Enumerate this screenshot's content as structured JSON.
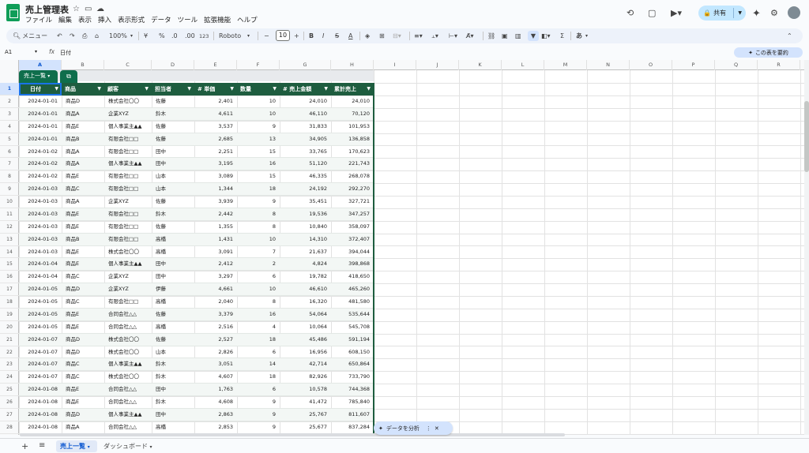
{
  "doc_title": "売上管理表",
  "title_icons": [
    "star-icon",
    "folder-icon",
    "cloud-icon"
  ],
  "menu": [
    "ファイル",
    "編集",
    "表示",
    "挿入",
    "表示形式",
    "データ",
    "ツール",
    "拡張機能",
    "ヘルプ"
  ],
  "share_label": "共有",
  "toolbar": {
    "search": "メニュー",
    "zoom": "100%",
    "currency": "¥",
    "percent": "%",
    "dec_less": ".0",
    "dec_more": ".00",
    "fmt123": "123",
    "font": "Roboto",
    "font_size": "10",
    "input_tools": "あ"
  },
  "formula": {
    "namebox": "A1",
    "fx": "fx",
    "value": "日付",
    "summarize": "この表を要約"
  },
  "col_letters": [
    "A",
    "B",
    "C",
    "D",
    "E",
    "F",
    "G",
    "H",
    "I",
    "J",
    "K",
    "L",
    "M",
    "N",
    "O",
    "P",
    "Q",
    "R"
  ],
  "table_name": "売上一覧",
  "headers": [
    "日付",
    "商品",
    "顧客",
    "担当者",
    "# 単価",
    "数量",
    "# 売上金額",
    "累計売上"
  ],
  "rows": [
    [
      "2024-01-01",
      "商品D",
      "株式会社〇〇",
      "佐藤",
      "2,401",
      "10",
      "24,010",
      "24,010"
    ],
    [
      "2024-01-01",
      "商品A",
      "企業XYZ",
      "鈴木",
      "4,611",
      "10",
      "46,110",
      "70,120"
    ],
    [
      "2024-01-01",
      "商品E",
      "個人事業主▲▲",
      "佐藤",
      "3,537",
      "9",
      "31,833",
      "101,953"
    ],
    [
      "2024-01-01",
      "商品B",
      "有限会社□□",
      "佐藤",
      "2,685",
      "13",
      "34,905",
      "136,858"
    ],
    [
      "2024-01-02",
      "商品A",
      "有限会社□□",
      "田中",
      "2,251",
      "15",
      "33,765",
      "170,623"
    ],
    [
      "2024-01-02",
      "商品A",
      "個人事業主▲▲",
      "田中",
      "3,195",
      "16",
      "51,120",
      "221,743"
    ],
    [
      "2024-01-02",
      "商品E",
      "有限会社□□",
      "山本",
      "3,089",
      "15",
      "46,335",
      "268,078"
    ],
    [
      "2024-01-03",
      "商品C",
      "有限会社□□",
      "山本",
      "1,344",
      "18",
      "24,192",
      "292,270"
    ],
    [
      "2024-01-03",
      "商品A",
      "企業XYZ",
      "佐藤",
      "3,939",
      "9",
      "35,451",
      "327,721"
    ],
    [
      "2024-01-03",
      "商品E",
      "有限会社□□",
      "鈴木",
      "2,442",
      "8",
      "19,536",
      "347,257"
    ],
    [
      "2024-01-03",
      "商品E",
      "有限会社□□",
      "佐藤",
      "1,355",
      "8",
      "10,840",
      "358,097"
    ],
    [
      "2024-01-03",
      "商品B",
      "有限会社□□",
      "高橋",
      "1,431",
      "10",
      "14,310",
      "372,407"
    ],
    [
      "2024-01-03",
      "商品E",
      "株式会社〇〇",
      "高橋",
      "3,091",
      "7",
      "21,637",
      "394,044"
    ],
    [
      "2024-01-04",
      "商品E",
      "個人事業主▲▲",
      "田中",
      "2,412",
      "2",
      "4,824",
      "398,868"
    ],
    [
      "2024-01-04",
      "商品C",
      "企業XYZ",
      "田中",
      "3,297",
      "6",
      "19,782",
      "418,650"
    ],
    [
      "2024-01-05",
      "商品D",
      "企業XYZ",
      "伊藤",
      "4,661",
      "10",
      "46,610",
      "465,260"
    ],
    [
      "2024-01-05",
      "商品C",
      "有限会社□□",
      "高橋",
      "2,040",
      "8",
      "16,320",
      "481,580"
    ],
    [
      "2024-01-05",
      "商品E",
      "合同会社△△",
      "佐藤",
      "3,379",
      "16",
      "54,064",
      "535,644"
    ],
    [
      "2024-01-05",
      "商品E",
      "合同会社△△",
      "高橋",
      "2,516",
      "4",
      "10,064",
      "545,708"
    ],
    [
      "2024-01-07",
      "商品D",
      "株式会社〇〇",
      "佐藤",
      "2,527",
      "18",
      "45,486",
      "591,194"
    ],
    [
      "2024-01-07",
      "商品D",
      "株式会社〇〇",
      "山本",
      "2,826",
      "6",
      "16,956",
      "608,150"
    ],
    [
      "2024-01-07",
      "商品C",
      "個人事業主▲▲",
      "鈴木",
      "3,051",
      "14",
      "42,714",
      "650,864"
    ],
    [
      "2024-01-07",
      "商品C",
      "株式会社〇〇",
      "鈴木",
      "4,607",
      "18",
      "82,926",
      "733,790"
    ],
    [
      "2024-01-08",
      "商品E",
      "合同会社△△",
      "田中",
      "1,763",
      "6",
      "10,578",
      "744,368"
    ],
    [
      "2024-01-08",
      "商品E",
      "合同会社△△",
      "鈴木",
      "4,608",
      "9",
      "41,472",
      "785,840"
    ],
    [
      "2024-01-08",
      "商品D",
      "個人事業主▲▲",
      "田中",
      "2,863",
      "9",
      "25,767",
      "811,607"
    ],
    [
      "2024-01-08",
      "商品A",
      "合同会社△△",
      "高橋",
      "2,853",
      "9",
      "25,677",
      "837,284"
    ]
  ],
  "analyze_label": "データを分析",
  "sheets": [
    "売上一覧",
    "ダッシュボード"
  ]
}
